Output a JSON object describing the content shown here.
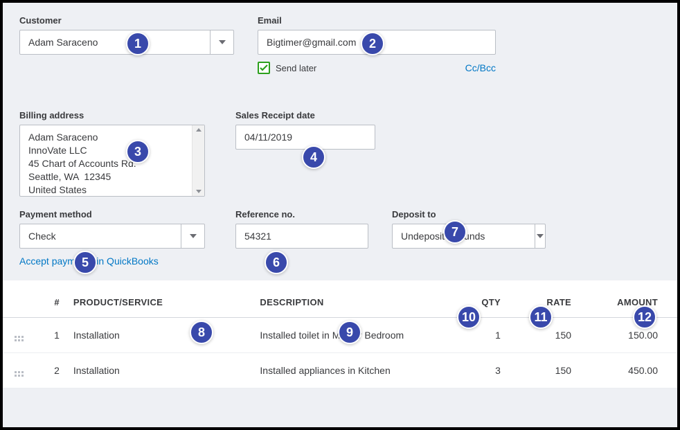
{
  "customer": {
    "label": "Customer",
    "value": "Adam Saraceno"
  },
  "email": {
    "label": "Email",
    "value": "Bigtimer@gmail.com",
    "send_later_label": "Send later",
    "send_later_checked": true,
    "ccbcc_label": "Cc/Bcc"
  },
  "billing_address": {
    "label": "Billing address",
    "value": "Adam Saraceno\nInnoVate LLC\n45 Chart of Accounts Rd.\nSeattle, WA  12345\nUnited States"
  },
  "receipt_date": {
    "label": "Sales Receipt date",
    "value": "04/11/2019"
  },
  "payment_method": {
    "label": "Payment method",
    "value": "Check",
    "accept_link": "Accept payments in QuickBooks"
  },
  "reference_no": {
    "label": "Reference no.",
    "value": "54321"
  },
  "deposit_to": {
    "label": "Deposit to",
    "value": "Undeposited Funds"
  },
  "table": {
    "headers": {
      "num": "#",
      "product": "PRODUCT/SERVICE",
      "description": "DESCRIPTION",
      "qty": "QTY",
      "rate": "RATE",
      "amount": "AMOUNT"
    },
    "rows": [
      {
        "num": "1",
        "product": "Installation",
        "description": "Installed toilet in Master Bedroom",
        "qty": "1",
        "rate": "150",
        "amount": "150.00"
      },
      {
        "num": "2",
        "product": "Installation",
        "description": "Installed appliances in Kitchen",
        "qty": "3",
        "rate": "150",
        "amount": "450.00"
      }
    ]
  },
  "badges": {
    "b1": "1",
    "b2": "2",
    "b3": "3",
    "b4": "4",
    "b5": "5",
    "b6": "6",
    "b7": "7",
    "b8": "8",
    "b9": "9",
    "b10": "10",
    "b11": "11",
    "b12": "12"
  }
}
